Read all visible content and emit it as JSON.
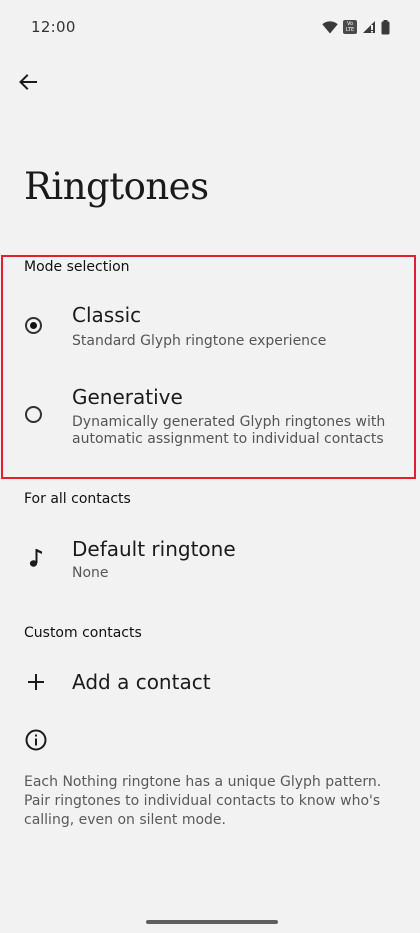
{
  "status_bar": {
    "time": "12:00",
    "volte_top": "Vo",
    "volte_bottom": "LTE"
  },
  "page": {
    "title": "Ringtones"
  },
  "mode_selection": {
    "header": "Mode selection",
    "selected": "classic",
    "options": [
      {
        "title": "Classic",
        "subtitle": "Standard Glyph ringtone experience",
        "checked": true
      },
      {
        "title": "Generative",
        "subtitle": "Dynamically generated Glyph ringtones with automatic assignment to individual contacts",
        "checked": false
      }
    ]
  },
  "all_contacts": {
    "header": "For all contacts",
    "default_ringtone": {
      "title": "Default ringtone",
      "value": "None",
      "icon": "music-note-icon"
    }
  },
  "custom_contacts": {
    "header": "Custom contacts",
    "add_contact": {
      "label": "Add a contact",
      "icon": "plus-icon"
    }
  },
  "info": {
    "icon": "info-icon",
    "text": "Each Nothing ringtone has a unique Glyph pattern. Pair ringtones to individual contacts to know who's calling, even on silent mode."
  },
  "colors": {
    "background": "#f2f2f2",
    "highlight_border": "#e3202a"
  }
}
